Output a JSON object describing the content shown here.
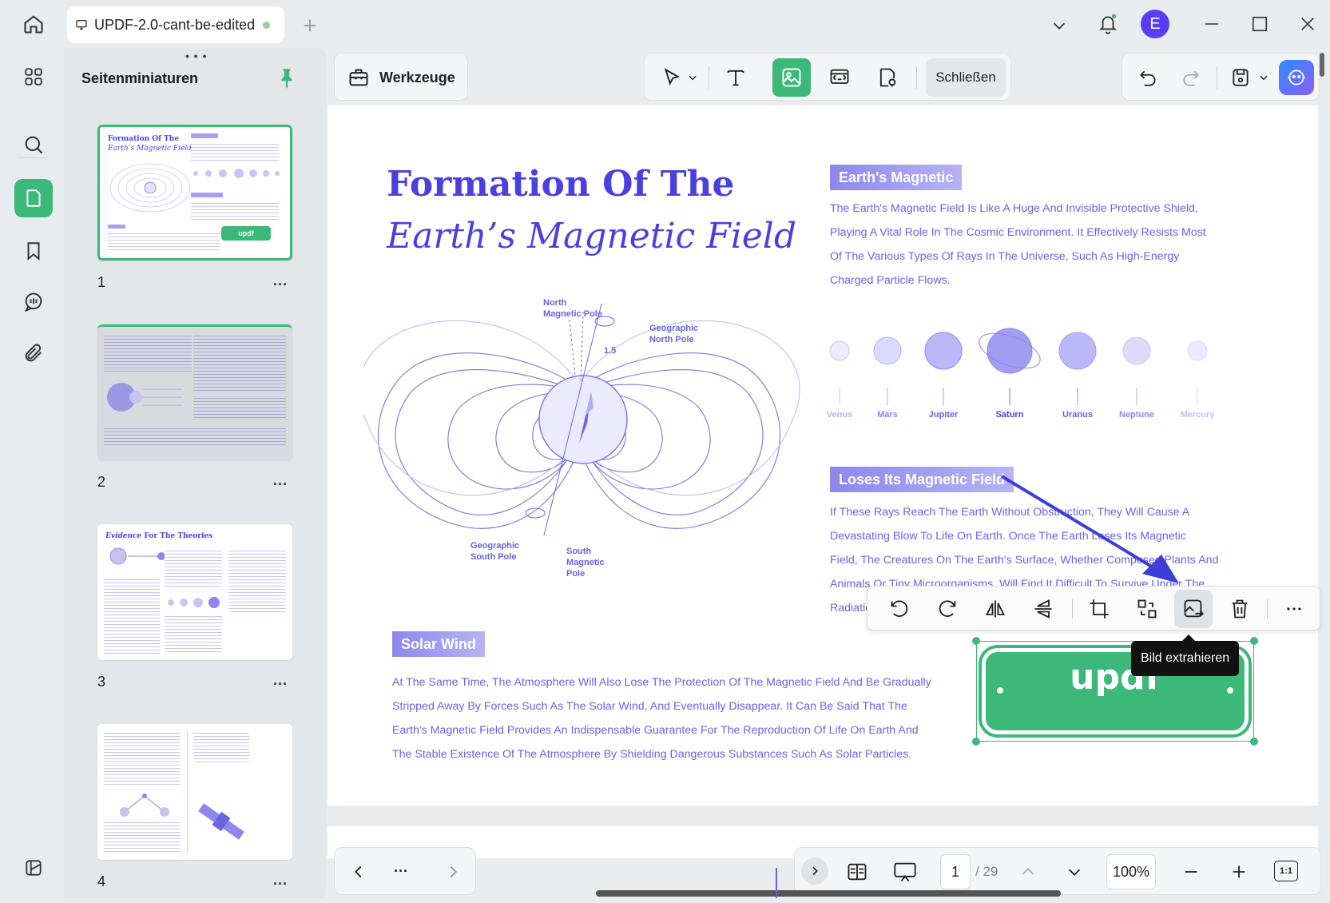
{
  "window": {
    "tab_title": "UPDF-2.0-cant-be-edited",
    "avatar_letter": "E",
    "icons": [
      "home-icon",
      "new-tab-icon",
      "chevron-down-icon",
      "bell-icon",
      "minimize-icon",
      "maximize-icon",
      "close-icon"
    ]
  },
  "rail": {
    "items": [
      "thumbnails-icon",
      "search-icon",
      "pages-icon",
      "bookmark-icon",
      "comment-icon",
      "attachment-icon",
      "layers-icon"
    ],
    "active": "pages-icon"
  },
  "thumbnails": {
    "title": "Seitenminiaturen",
    "pages": [
      {
        "number": "1",
        "title_line1": "Formation Of The",
        "title_line2": "Earth’s Magnetic Field",
        "badge": "updf"
      },
      {
        "number": "2"
      },
      {
        "number": "3",
        "title_italic": "Evidence",
        "title_rest": " For The Theories"
      },
      {
        "number": "4"
      }
    ],
    "more": "..."
  },
  "toolbar": {
    "tools_label": "Werkzeuge",
    "close_label": "Schließen",
    "accent": "#3cb878"
  },
  "document": {
    "title_line1": "Formation Of The",
    "title_line2": "Earth’s Magnetic Field",
    "section1": {
      "heading": "Earth's Magnetic",
      "lines": [
        "The Earth's Magnetic Field Is Like A Huge And Invisible Protective Shield,",
        "Playing A Vital Role In The Cosmic Environment. It Effectively Resists Most",
        "Of The Various Types Of Rays In The Universe, Such As High-Energy",
        "Charged Particle Flows."
      ]
    },
    "planets": [
      "Venus",
      "Mars",
      "Jupiter",
      "Saturn",
      "Uranus",
      "Neptune",
      "Mercury"
    ],
    "section2": {
      "heading": "Loses Its Magnetic Field",
      "lines": [
        "If These Rays Reach The Earth Without Obstruction, They Will Cause A",
        "Devastating Blow To Life On Earth. Once The Earth Loses Its Magnetic",
        "Field, The Creatures On The Earth's Surface, Whether Composed Plants And",
        "Animals Or Tiny Microorganisms, Will Find It Difficult To Survive Under The",
        "Radiation"
      ]
    },
    "section3": {
      "heading": "Solar Wind",
      "lines": [
        "At The Same Time, The Atmosphere Will Also Lose The Protection Of The Magnetic Field And Be Gradually",
        "Stripped Away By Forces Such As The Solar Wind, And Eventually Disappear. It Can Be Said That The",
        "Earth's Magnetic Field Provides An Indispensable Guarantee For The Reproduction Of Life On Earth And",
        "The Stable Existence Of The Atmosphere By Shielding Dangerous Substances Such As Solar Particles."
      ]
    },
    "diagram": {
      "north_magnetic": [
        "North",
        "Magnetic Pole"
      ],
      "geo_north": [
        "Geographic",
        "North Pole"
      ],
      "geo_south": [
        "Geographic",
        "South Pole"
      ],
      "south_magnetic": [
        "South",
        "Magnetic",
        "Pole"
      ],
      "angle": "1.5"
    },
    "image_text": "updf"
  },
  "image_toolbar": {
    "icons": [
      "rotate-left-icon",
      "rotate-right-icon",
      "flip-horizontal-icon",
      "flip-vertical-icon",
      "crop-icon",
      "replace-icon",
      "extract-image-icon",
      "delete-icon",
      "more-icon"
    ],
    "tooltip": "Bild extrahieren"
  },
  "bottom": {
    "more": "...",
    "page_current": "1",
    "page_total": "/ 29",
    "zoom": "100%",
    "fit_label": "1:1"
  }
}
